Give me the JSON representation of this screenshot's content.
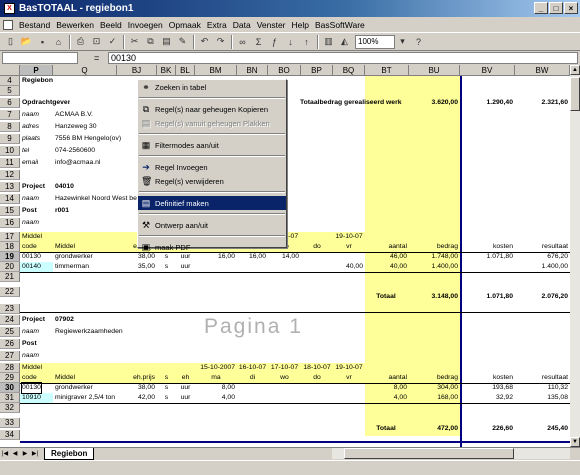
{
  "window": {
    "title": "BasTOTAAL - regiebon1",
    "app_icon": "excel-icon"
  },
  "menu": [
    "Bestand",
    "Bewerken",
    "Beeld",
    "Invoegen",
    "Opmaak",
    "Extra",
    "Data",
    "Venster",
    "Help",
    "BasSoftWare"
  ],
  "toolbar": {
    "zoom": "100%"
  },
  "formula": {
    "name_box": "",
    "value": "00130"
  },
  "columns": [
    "P",
    "Q",
    "BJ",
    "BK",
    "BL",
    "BM",
    "BN",
    "BO",
    "BP",
    "BQ",
    "BT",
    "BU",
    "BV",
    "BW"
  ],
  "rows": [
    "4",
    "5",
    "6",
    "7",
    "8",
    "9",
    "10",
    "11",
    "12",
    "13",
    "14",
    "15",
    "16",
    "17",
    "18",
    "19",
    "20",
    "21",
    "22",
    "23",
    "24",
    "25",
    "26",
    "27",
    "28",
    "29",
    "30",
    "31",
    "32",
    "33",
    "34"
  ],
  "sheet": {
    "regiebon": "Regiebon",
    "opdrachtgever": "Opdrachtgever",
    "lbl_naam": "naam",
    "lbl_adres": "adres",
    "lbl_plaats": "plaats",
    "lbl_tel": "tel",
    "lbl_email": "email",
    "client_naam": "ACMAA B.V.",
    "client_adres": "Hanzeweg 30",
    "client_plaats": "7556 BM Hengelo(ov)",
    "client_tel": "074-2560600",
    "client_email": "info@acmaa.nl",
    "totaal_label": "Totaalbedrag gerealiseerd werk",
    "totaal_bu": "3.620,00",
    "totaal_bv": "1.290,40",
    "totaal_bw": "2.321,60",
    "project1": {
      "label": "Project",
      "nr": "04010",
      "naam": "Hazewinkel Noord West bestek",
      "post_label": "Post",
      "post": "r001",
      "hdr_middel": "Middel",
      "hdr_code": "code",
      "hdr_middel2": "Middel",
      "hdr_ehprijs": "eh.prijs",
      "hdr_s": "s",
      "hdr_eh": "eh",
      "hdr_ma": "ma",
      "hdr_di": "di",
      "hdr_wo": "wo",
      "hdr_do": "do",
      "hdr_vr": "vr",
      "hdr_date1": "18-10-07",
      "hdr_date2": "19-10-07",
      "hdr_aantal": "aantal",
      "hdr_bedrag": "bedrag",
      "hdr_kosten": "kosten",
      "hdr_resultaat": "resultaat",
      "lines": [
        {
          "code": "00130",
          "middel": "grondwerker",
          "prijs": "38,00",
          "s": "s",
          "eh": "uur",
          "ma": "16,00",
          "di": "16,00",
          "wo": "14,00",
          "vr": "",
          "aantal": "46,00",
          "bedrag": "1.748,00",
          "kosten": "1.071,80",
          "resultaat": "676,20"
        },
        {
          "code": "00140",
          "middel": "timmerman",
          "prijs": "35,00",
          "s": "s",
          "eh": "uur",
          "ma": "",
          "di": "",
          "wo": "",
          "vr": "40,00",
          "aantal": "40,00",
          "bedrag": "1.400,00",
          "kosten": "",
          "resultaat": "1.400,00"
        }
      ],
      "totaal_label": "Totaal",
      "totaal_bedrag": "3.148,00",
      "totaal_kosten": "1.071,80",
      "totaal_resultaat": "2.076,20"
    },
    "project2": {
      "label": "Project",
      "nr": "07902",
      "naam_label": "naam",
      "naam": "Regiewerkzaamheden",
      "post_label": "Post",
      "post_naam_label": "naam",
      "hdr_middel": "Middel",
      "hdr_d1": "15-10-2007",
      "hdr_d2": "16-10-07",
      "hdr_d3": "17-10-07",
      "hdr_d4": "18-10-07",
      "hdr_d5": "19-10-07",
      "hdr_code": "code",
      "hdr_middel2": "Middel",
      "hdr_ehprijs": "eh.prijs",
      "hdr_s": "s",
      "hdr_eh": "eh",
      "hdr_ma": "ma",
      "hdr_di": "di",
      "hdr_wo": "wo",
      "hdr_do": "do",
      "hdr_vr": "vr",
      "hdr_aantal": "aantal",
      "hdr_bedrag": "bedrag",
      "hdr_kosten": "kosten",
      "hdr_resultaat": "resultaat",
      "lines": [
        {
          "code": "00130",
          "middel": "grondwerker",
          "prijs": "38,00",
          "s": "s",
          "eh": "uur",
          "ma": "8,00",
          "aantal": "8,00",
          "bedrag": "304,00",
          "kosten": "193,68",
          "resultaat": "110,32"
        },
        {
          "code": "10910",
          "middel": "minigraver 2,5/4 ton",
          "prijs": "42,00",
          "s": "s",
          "eh": "uur",
          "ma": "4,00",
          "aantal": "4,00",
          "bedrag": "168,00",
          "kosten": "32,92",
          "resultaat": "135,08"
        }
      ],
      "totaal_label": "Totaal",
      "totaal_bedrag": "472,00",
      "totaal_kosten": "226,60",
      "totaal_resultaat": "245,40"
    },
    "watermark": "Pagina 1"
  },
  "context_menu": [
    {
      "label": "Zoeken in tabel",
      "icon": "binoculars-icon",
      "enabled": true
    },
    {
      "label": "Regel(s) naar geheugen Kopieren",
      "icon": "copy-icon",
      "enabled": true
    },
    {
      "label": "Regel(s) vanuit geheugen Plakken",
      "icon": "paste-icon",
      "enabled": false
    },
    {
      "label": "Filtermodes aan/uit",
      "icon": "filter-icon",
      "enabled": true
    },
    {
      "label": "Regel Invoegen",
      "icon": "arrow-right-icon",
      "enabled": true
    },
    {
      "label": "Regel(s) verwijderen",
      "icon": "trash-icon",
      "enabled": true
    },
    {
      "label": "Definitief maken",
      "icon": "finalize-icon",
      "enabled": true
    },
    {
      "label": "Ontwerp aan/uit",
      "icon": "tools-icon",
      "enabled": true
    },
    {
      "label": "maak PDF",
      "icon": "pdf-icon",
      "enabled": true
    }
  ],
  "tabs": {
    "sheet": "Regiebon"
  }
}
